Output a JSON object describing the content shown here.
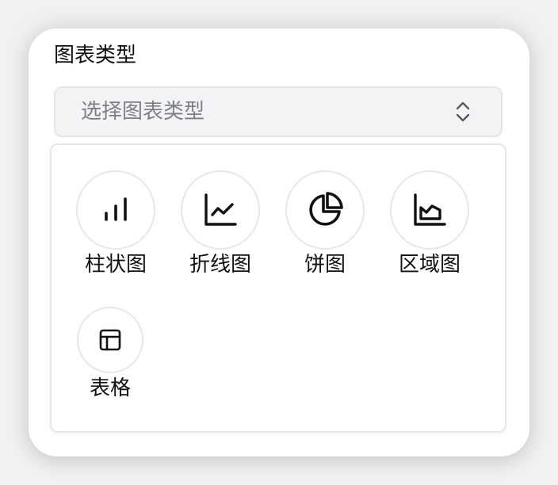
{
  "field": {
    "label": "图表类型"
  },
  "select": {
    "placeholder": "选择图表类型",
    "chevron_icon": "chevron-up-down-icon"
  },
  "options": [
    {
      "label": "柱状图",
      "icon": "bar-chart-icon"
    },
    {
      "label": "折线图",
      "icon": "line-chart-icon"
    },
    {
      "label": "饼图",
      "icon": "pie-chart-icon"
    },
    {
      "label": "区域图",
      "icon": "area-chart-icon"
    },
    {
      "label": "表格",
      "icon": "table-icon"
    }
  ],
  "colors": {
    "icon_stroke": "#111111",
    "placeholder_text": "#7b8088",
    "select_background": "#f2f3f5"
  }
}
